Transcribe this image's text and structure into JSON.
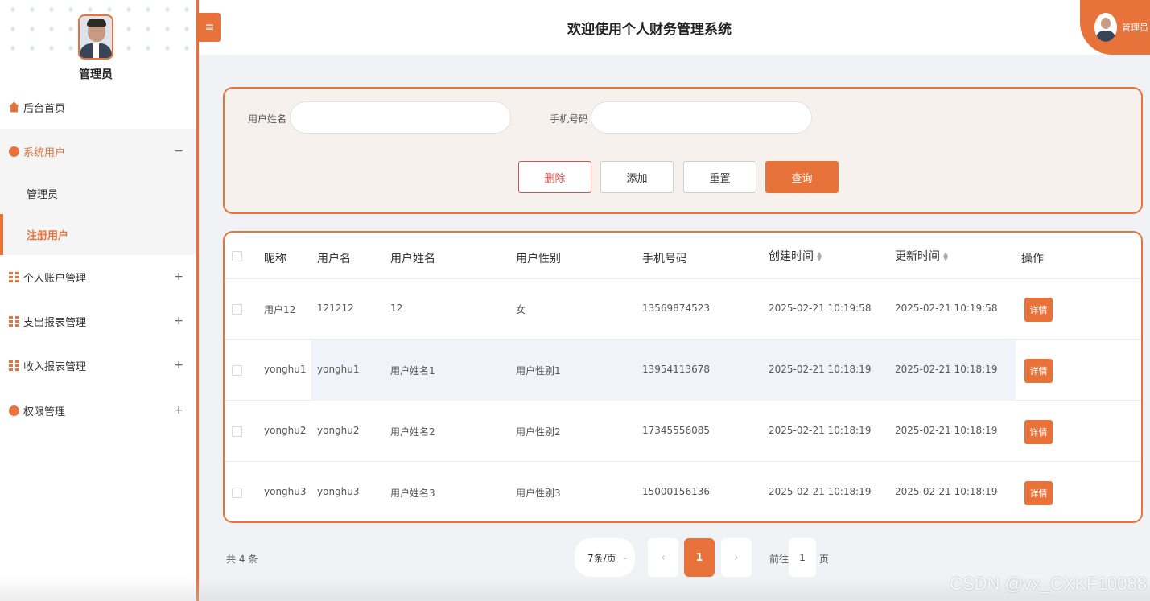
{
  "sidebar": {
    "admin_name": "管理员",
    "items": [
      {
        "label": "后台首页",
        "icon": "home-icon"
      },
      {
        "label": "系统用户",
        "icon": "user-icon",
        "toggle": "−"
      },
      {
        "label": "管理员"
      },
      {
        "label": "注册用户"
      },
      {
        "label": "个人账户管理",
        "icon": "grid-icon",
        "toggle": "+"
      },
      {
        "label": "支出报表管理",
        "icon": "grid-icon",
        "toggle": "+"
      },
      {
        "label": "收入报表管理",
        "icon": "grid-icon",
        "toggle": "+"
      },
      {
        "label": "权限管理",
        "icon": "user-icon",
        "toggle": "+"
      }
    ]
  },
  "header": {
    "toggle_icon": "≡",
    "title": "欢迎使用个人财务管理系统",
    "user_label": "管理员"
  },
  "search": {
    "name_label": "用户姓名",
    "name_value": "",
    "phone_label": "手机号码",
    "phone_value": ""
  },
  "buttons": {
    "delete": "删除",
    "add": "添加",
    "reset": "重置",
    "query": "查询"
  },
  "table": {
    "headers": [
      "昵称",
      "用户名",
      "用户姓名",
      "用户性别",
      "手机号码",
      "创建时间",
      "更新时间",
      "操作"
    ],
    "detail_label": "详情",
    "rows": [
      [
        "用户12",
        "121212",
        "12",
        "女",
        "13569874523",
        "2025-02-21 10:19:58",
        "2025-02-21 10:19:58"
      ],
      [
        "yonghu1",
        "yonghu1",
        "用户姓名1",
        "用户性别1",
        "13954113678",
        "2025-02-21 10:18:19",
        "2025-02-21 10:18:19"
      ],
      [
        "yonghu2",
        "yonghu2",
        "用户姓名2",
        "用户性别2",
        "17345556085",
        "2025-02-21 10:18:19",
        "2025-02-21 10:18:19"
      ],
      [
        "yonghu3",
        "yonghu3",
        "用户姓名3",
        "用户性别3",
        "15000156136",
        "2025-02-21 10:18:19",
        "2025-02-21 10:18:19"
      ]
    ]
  },
  "pagination": {
    "total": "共 4 条",
    "page_size": "7条/页",
    "prev": "‹",
    "current": "1",
    "next": "›",
    "goto_prefix": "前往",
    "goto_value": "1",
    "goto_suffix": "页"
  },
  "watermark": "CSDN @vx_CXKF10088",
  "colors": {
    "accent": "#e8733a",
    "danger": "#d9534f"
  }
}
